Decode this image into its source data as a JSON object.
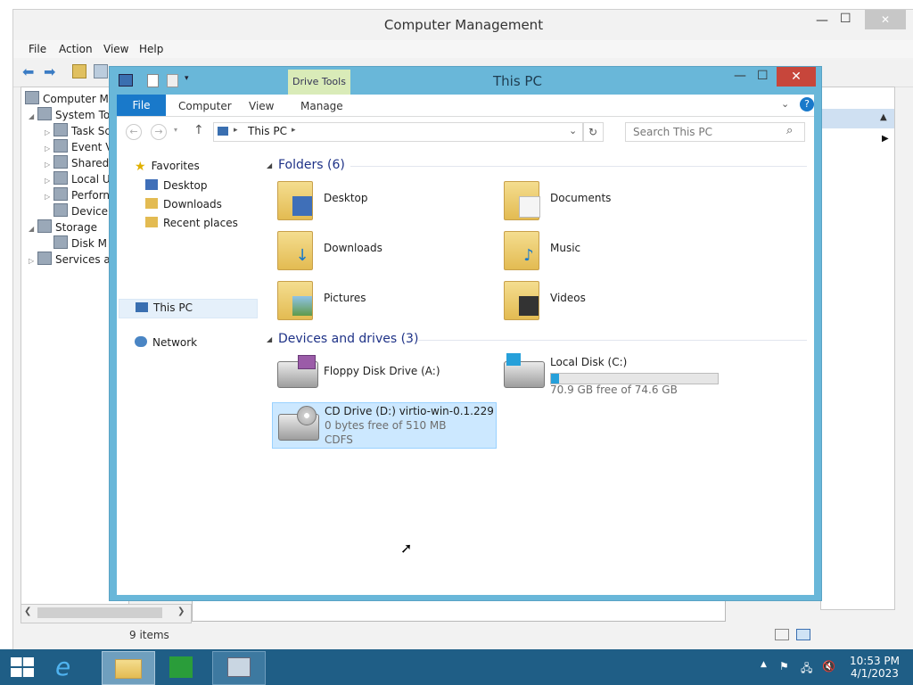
{
  "cm": {
    "title": "Computer Management",
    "menu": [
      "File",
      "Action",
      "View",
      "Help"
    ],
    "tree": [
      {
        "label": "Computer Ma",
        "icon": "computer-icon"
      },
      {
        "label": "System To",
        "icon": "tools-icon"
      },
      {
        "label": "Task Sc",
        "icon": "clock-icon"
      },
      {
        "label": "Event V",
        "icon": "event-viewer-icon"
      },
      {
        "label": "Shared",
        "icon": "shared-folder-icon"
      },
      {
        "label": "Local U",
        "icon": "users-icon"
      },
      {
        "label": "Perforn",
        "icon": "performance-icon"
      },
      {
        "label": "Device",
        "icon": "device-manager-icon"
      },
      {
        "label": "Storage",
        "icon": "storage-icon"
      },
      {
        "label": "Disk M",
        "icon": "disk-icon"
      },
      {
        "label": "Services ar",
        "icon": "services-icon"
      }
    ]
  },
  "explorer": {
    "title": "This PC",
    "drive_tools": "Drive Tools",
    "tabs": [
      "File",
      "Computer",
      "View",
      "Manage"
    ],
    "address": "This PC",
    "search_placeholder": "Search This PC",
    "nav": {
      "favorites": "Favorites",
      "items": [
        "Desktop",
        "Downloads",
        "Recent places"
      ],
      "this_pc": "This PC",
      "network": "Network"
    },
    "folders_header": "Folders (6)",
    "folders": [
      {
        "label": "Desktop",
        "icon": "desktop-folder-icon"
      },
      {
        "label": "Documents",
        "icon": "documents-folder-icon"
      },
      {
        "label": "Downloads",
        "icon": "downloads-folder-icon"
      },
      {
        "label": "Music",
        "icon": "music-folder-icon"
      },
      {
        "label": "Pictures",
        "icon": "pictures-folder-icon"
      },
      {
        "label": "Videos",
        "icon": "videos-folder-icon"
      }
    ],
    "drives_header": "Devices and drives (3)",
    "drives": {
      "floppy": {
        "label": "Floppy Disk Drive (A:)"
      },
      "local": {
        "label": "Local Disk (C:)",
        "free": "70.9 GB free of 74.6 GB",
        "used_fraction": 0.05
      },
      "cd": {
        "label": "CD Drive (D:) virtio-win-0.1.229",
        "free": "0 bytes free of 510 MB",
        "fs": "CDFS"
      }
    },
    "status": "9 items"
  },
  "taskbar": {
    "time": "10:53 PM",
    "date": "4/1/2023",
    "apps": [
      "start-icon",
      "internet-explorer-icon",
      "file-explorer-icon",
      "store-icon",
      "computer-management-icon"
    ]
  },
  "colors": {
    "accent": "#1979ca",
    "title_bar": "#69b7d9",
    "close": "#c7463b",
    "taskbar": "#1f5e86",
    "selection": "#cce8ff"
  }
}
